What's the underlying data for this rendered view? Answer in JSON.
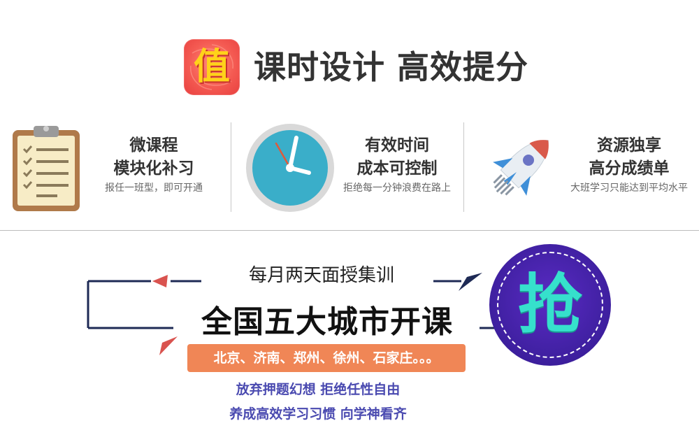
{
  "header": {
    "logo_char": "值",
    "title": "课时设计 高效提分"
  },
  "features": [
    {
      "icon": "clipboard-icon",
      "line1": "微课程",
      "line2": "模块化补习",
      "sub": "报任一班型，即可开通"
    },
    {
      "icon": "clock-icon",
      "line1": "有效时间",
      "line2": "成本可控制",
      "sub": "拒绝每一分钟浪费在路上"
    },
    {
      "icon": "rocket-icon",
      "line1": "资源独享",
      "line2": "高分成绩单",
      "sub": "大班学习只能达到平均水平"
    }
  ],
  "promo": {
    "monthly": "每月两天面授集训",
    "title": "全国五大城市开课",
    "cities": "北京、济南、郑州、徐州、石家庄。。。",
    "slogan1": "放弃押题幻想 拒绝任性自由",
    "slogan2": "养成高效学习习惯 向学神看齐",
    "badge_char": "抢"
  },
  "colors": {
    "logo_bg": "#f45a52",
    "logo_char": "#ffd21a",
    "banner_bg": "#f08656",
    "slogan": "#4a4ab0",
    "badge_bg": "#3d1f9e",
    "badge_char": "#36e0cc",
    "bracket_line": "#1e2a55",
    "arrow_red": "#d9534f"
  }
}
